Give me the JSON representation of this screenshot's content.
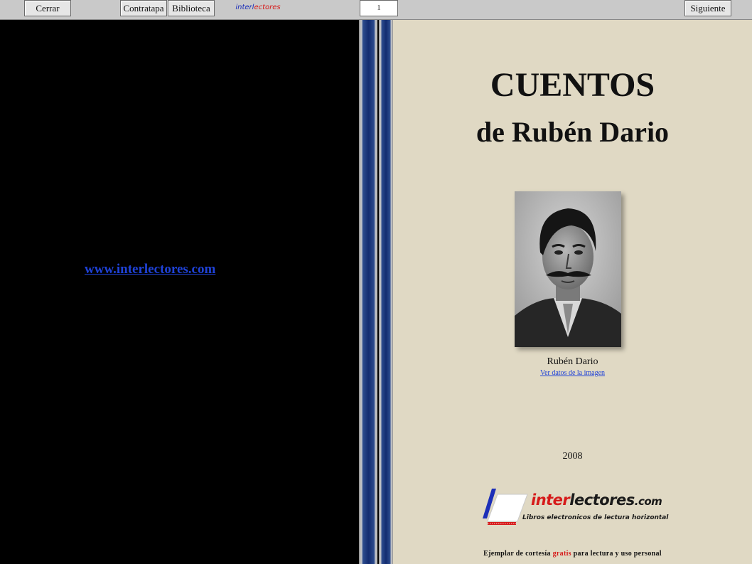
{
  "toolbar": {
    "close_label": "Cerrar",
    "back_cover_label": "Contratapa",
    "library_label": "Biblioteca",
    "brand_part1": "interl",
    "brand_part2": "ectores",
    "page_number": "1",
    "next_label": "Siguiente"
  },
  "left_page": {
    "site_link": "www.interlectores.com"
  },
  "cover": {
    "title": "CUENTOS",
    "subtitle": "de Rubén Dario",
    "portrait_caption": "Rubén Dario",
    "image_info_link": "Ver datos de la imagen",
    "year": "2008",
    "logo_name_part1": "inter",
    "logo_name_part2": "lectores",
    "logo_domain": ".com",
    "logo_tagline": "Libros electronicos de lectura horizontal",
    "footer_before": "Ejemplar de cortesía",
    "footer_highlight": "gratis",
    "footer_after": "para lectura y uso personal"
  },
  "colors": {
    "page_background": "#e0d9c4",
    "link_blue": "#1f42d8",
    "brand_red": "#d61a1a",
    "spine_navy": "#132c70"
  }
}
